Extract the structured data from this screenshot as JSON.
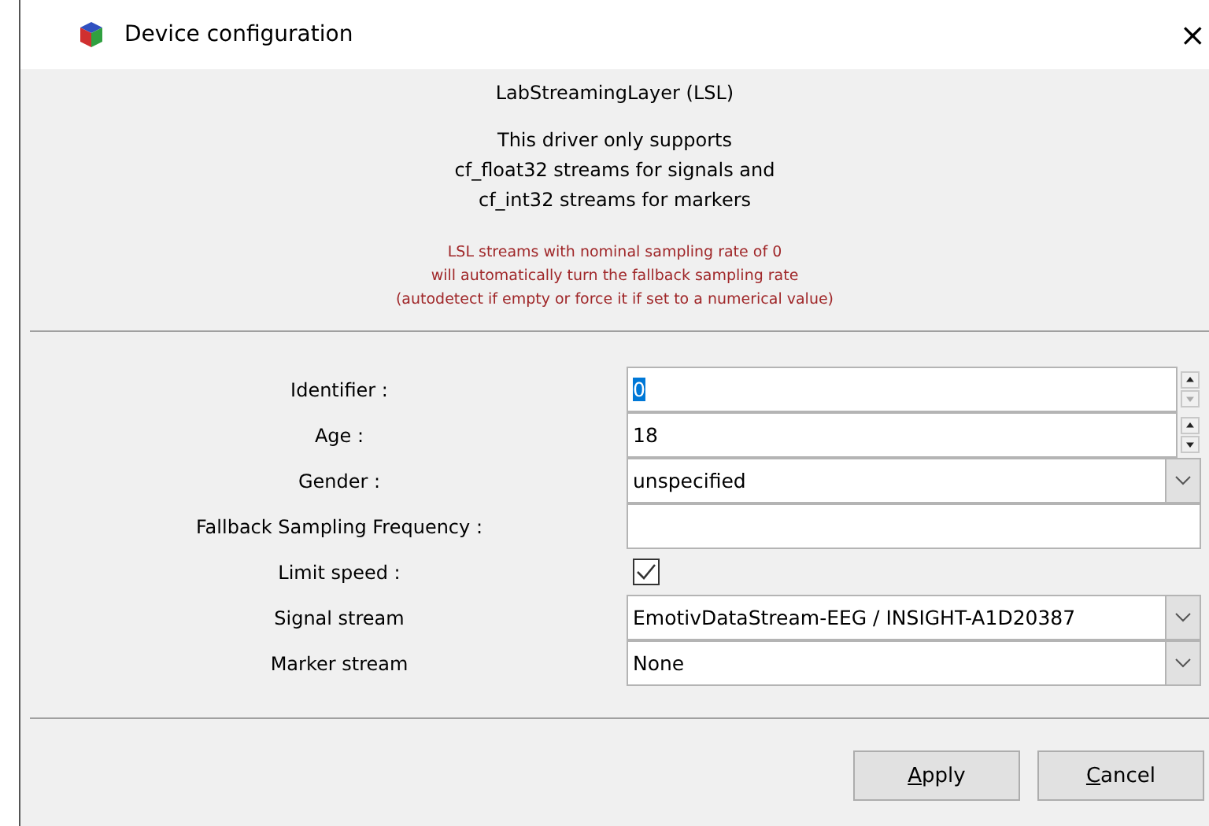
{
  "window": {
    "title": "Device configuration",
    "close": "×"
  },
  "header": {
    "title": "LabStreamingLayer (LSL)",
    "description": [
      "This driver only supports",
      "cf_float32 streams for signals and",
      "cf_int32 streams for markers"
    ],
    "warning": [
      "LSL streams with nominal sampling rate of 0",
      "will automatically turn the fallback sampling rate",
      "(autodetect if empty or force it if set to a numerical value)"
    ]
  },
  "fields": [
    {
      "kind": "spin",
      "label": "Identifier :",
      "value": "0",
      "value_highlighted": true,
      "down_disabled": true
    },
    {
      "kind": "spin",
      "label": "Age :",
      "value": "18",
      "value_highlighted": false,
      "down_disabled": false
    },
    {
      "kind": "combo",
      "label": "Gender :",
      "value": "unspecified"
    },
    {
      "kind": "text",
      "label": "Fallback Sampling Frequency :"
    },
    {
      "kind": "checkbox",
      "label": "Limit speed :",
      "checked": true
    },
    {
      "kind": "combo",
      "label": "Signal stream",
      "value": "EmotivDataStream-EEG / INSIGHT-A1D20387"
    },
    {
      "kind": "combo",
      "label": "Marker stream",
      "value": "None"
    }
  ],
  "buttons": [
    {
      "label": "Apply"
    },
    {
      "label": "Cancel"
    }
  ]
}
